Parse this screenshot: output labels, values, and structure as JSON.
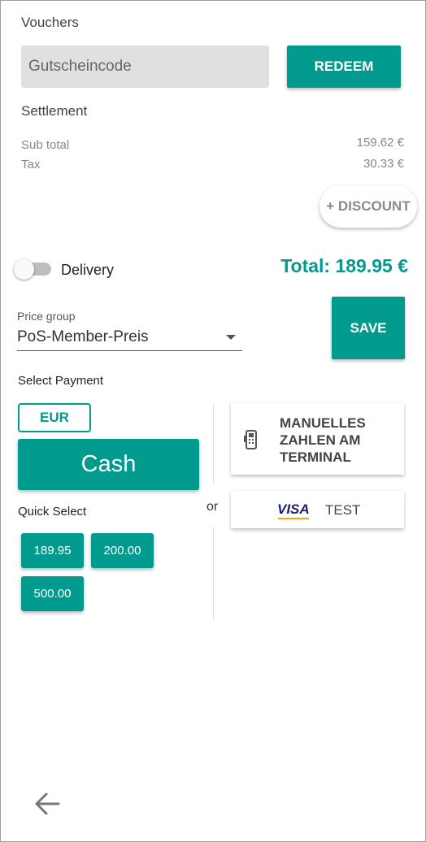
{
  "vouchers": {
    "title": "Vouchers",
    "placeholder": "Gutscheincode",
    "redeem_label": "REDEEM"
  },
  "settlement": {
    "title": "Settlement",
    "subtotal_label": "Sub total",
    "subtotal_value": "159.62 €",
    "tax_label": "Tax",
    "tax_value": "30.33 €",
    "discount_label": "+ DISCOUNT"
  },
  "delivery": {
    "label": "Delivery",
    "enabled": false
  },
  "total": {
    "text": "Total: 189.95 €"
  },
  "price_group": {
    "label": "Price group",
    "value": "PoS-Member-Preis",
    "save_label": "SAVE"
  },
  "payment": {
    "title": "Select Payment",
    "currency": "EUR",
    "cash_label": "Cash",
    "quick_select_label": "Quick Select",
    "quick_amounts": [
      "189.95",
      "200.00",
      "500.00"
    ],
    "or_label": "or",
    "methods": [
      {
        "label": "MANUELLES ZAHLEN AM TERMINAL",
        "icon": "card-terminal-icon"
      },
      {
        "brand": "VISA",
        "label": "TEST",
        "icon": "visa-logo"
      }
    ]
  },
  "colors": {
    "accent": "#009a8e",
    "input_bg": "#e0e0e0"
  },
  "nav": {
    "back_icon": "arrow-left-icon"
  }
}
